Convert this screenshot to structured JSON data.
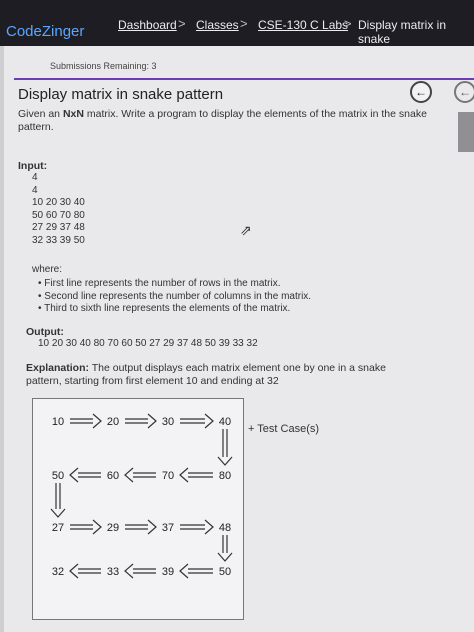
{
  "app": {
    "logo": "CodeZinger"
  },
  "breadcrumb": {
    "items": [
      "Dashboard",
      "Classes",
      "CSE-130 C Labs",
      "Display matrix in snake"
    ],
    "sep": ">"
  },
  "submissions": "Submissions Remaining: 3",
  "problem": {
    "title": "Display matrix in snake pattern",
    "desc_pre": "Given an ",
    "desc_bold": "NxN",
    "desc_post": " matrix. Write a program to display the elements of the matrix in the snake pattern.",
    "input_label": "Input:",
    "input_lines": [
      "4",
      "4",
      "10 20 30 40",
      "50 60 70 80",
      "27 29 37 48",
      "32 33 39 50"
    ],
    "where_label": "where:",
    "where_items": [
      "First line represents the number of rows in the matrix.",
      "Second line represents the number of columns in the matrix.",
      "Third to sixth line represents the elements of the matrix."
    ],
    "output_label": "Output:",
    "output_value": "10 20 30 40 80 70 60 50 27 29 37 48 50 39 33 32",
    "explanation_label": "Explanation:",
    "explanation_text": " The output displays each matrix element one by one in a snake pattern, starting from first element 10 and ending at 32"
  },
  "diagram": {
    "rows": [
      [
        "10",
        "20",
        "30",
        "40"
      ],
      [
        "50",
        "60",
        "70",
        "80"
      ],
      [
        "27",
        "29",
        "37",
        "48"
      ],
      [
        "32",
        "33",
        "39",
        "50"
      ]
    ]
  },
  "test_case": "+ Test Case(s)",
  "colors": {
    "topbar": "#1f1d24",
    "accent": "#6d3bb6",
    "logo": "#5aa6ff"
  }
}
